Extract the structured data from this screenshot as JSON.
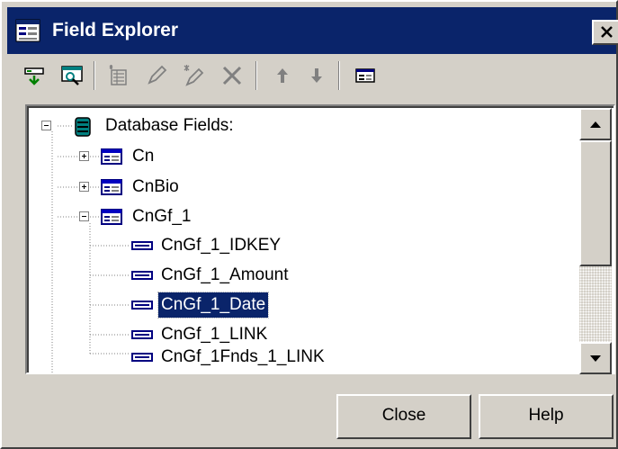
{
  "window": {
    "title": "Field Explorer"
  },
  "toolbar": {
    "buttons": [
      {
        "name": "insert-field-icon",
        "enabled": true
      },
      {
        "name": "browse-data-icon",
        "enabled": true
      },
      {
        "name": "new-icon",
        "enabled": false
      },
      {
        "name": "edit-icon",
        "enabled": false
      },
      {
        "name": "rename-icon",
        "enabled": false
      },
      {
        "name": "delete-icon",
        "enabled": false
      },
      {
        "name": "move-up-icon",
        "enabled": false
      },
      {
        "name": "move-down-icon",
        "enabled": false
      },
      {
        "name": "show-field-type-icon",
        "enabled": true
      }
    ]
  },
  "tree": {
    "root": "Database Fields:",
    "tables": [
      "Cn",
      "CnBio",
      "CnGf_1"
    ],
    "fields": [
      "CnGf_1_IDKEY",
      "CnGf_1_Amount",
      "CnGf_1_Date",
      "CnGf_1_LINK",
      "CnGf_1Fnds_1_LINK"
    ],
    "selected_field": "CnGf_1_Date"
  },
  "buttons": {
    "close": "Close",
    "help": "Help"
  },
  "colors": {
    "title_bar": "#0a246a",
    "selection": "#0a246a",
    "face": "#d4d0c8"
  }
}
